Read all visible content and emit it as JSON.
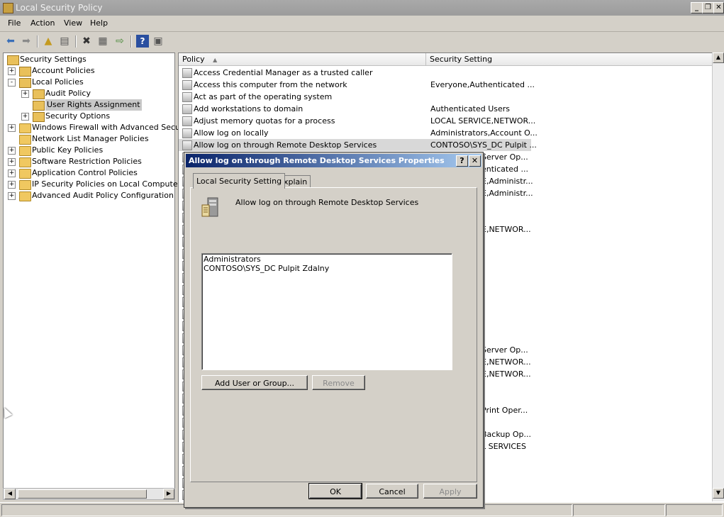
{
  "window": {
    "title": "Local Security Policy"
  },
  "menu": [
    "File",
    "Action",
    "View",
    "Help"
  ],
  "tree": {
    "root": "Security Settings",
    "items": [
      {
        "label": "Account Policies",
        "expander": "+",
        "level": 1
      },
      {
        "label": "Local Policies",
        "expander": "-",
        "level": 1
      },
      {
        "label": "Audit Policy",
        "expander": "+",
        "level": 2
      },
      {
        "label": "User Rights Assignment",
        "expander": "",
        "level": 2,
        "selected": true
      },
      {
        "label": "Security Options",
        "expander": "+",
        "level": 2
      },
      {
        "label": "Windows Firewall with Advanced Security",
        "expander": "+",
        "level": 1
      },
      {
        "label": "Network List Manager Policies",
        "expander": "",
        "level": 1
      },
      {
        "label": "Public Key Policies",
        "expander": "+",
        "level": 1
      },
      {
        "label": "Software Restriction Policies",
        "expander": "+",
        "level": 1
      },
      {
        "label": "Application Control Policies",
        "expander": "+",
        "level": 1
      },
      {
        "label": "IP Security Policies on Local Computer",
        "expander": "+",
        "level": 1
      },
      {
        "label": "Advanced Audit Policy Configuration",
        "expander": "+",
        "level": 1
      }
    ]
  },
  "list": {
    "columns": [
      "Policy",
      "Security Setting"
    ],
    "rows": [
      {
        "policy": "Access Credential Manager as a trusted caller",
        "setting": ""
      },
      {
        "policy": "Access this computer from the network",
        "setting": "Everyone,Authenticated ..."
      },
      {
        "policy": "Act as part of the operating system",
        "setting": ""
      },
      {
        "policy": "Add workstations to domain",
        "setting": "Authenticated Users"
      },
      {
        "policy": "Adjust memory quotas for a process",
        "setting": "LOCAL SERVICE,NETWOR..."
      },
      {
        "policy": "Allow log on locally",
        "setting": "Administrators,Account O..."
      },
      {
        "policy": "Allow log on through Remote Desktop Services",
        "setting": "CONTOSO\\SYS_DC Pulpit ...",
        "selected": true
      }
    ],
    "partial_settings": [
      {
        "row": 7,
        "text": "Server Op..."
      },
      {
        "row": 8,
        "text": "enticated ..."
      },
      {
        "row": 9,
        "text": "E,Administr..."
      },
      {
        "row": 10,
        "text": "E,Administr..."
      },
      {
        "row": 13,
        "text": "E,NETWOR..."
      },
      {
        "row": 23,
        "text": "Server Op..."
      },
      {
        "row": 24,
        "text": "E,NETWOR..."
      },
      {
        "row": 25,
        "text": "E,NETWOR..."
      },
      {
        "row": 28,
        "text": "Print Oper..."
      },
      {
        "row": 30,
        "text": "Backup Op..."
      },
      {
        "row": 31,
        "text": "L SERVICES"
      }
    ]
  },
  "dialog": {
    "title": "Allow log on through Remote Desktop Services Properties",
    "help_button": "?",
    "close_button": "✕",
    "tabs": [
      "Local Security Setting",
      "Explain"
    ],
    "heading": "Allow log on through Remote Desktop Services",
    "members": [
      "Administrators",
      "CONTOSO\\SYS_DC Pulpit Zdalny"
    ],
    "add_button": "Add User or Group...",
    "remove_button": "Remove",
    "ok_button": "OK",
    "cancel_button": "Cancel",
    "apply_button": "Apply"
  }
}
